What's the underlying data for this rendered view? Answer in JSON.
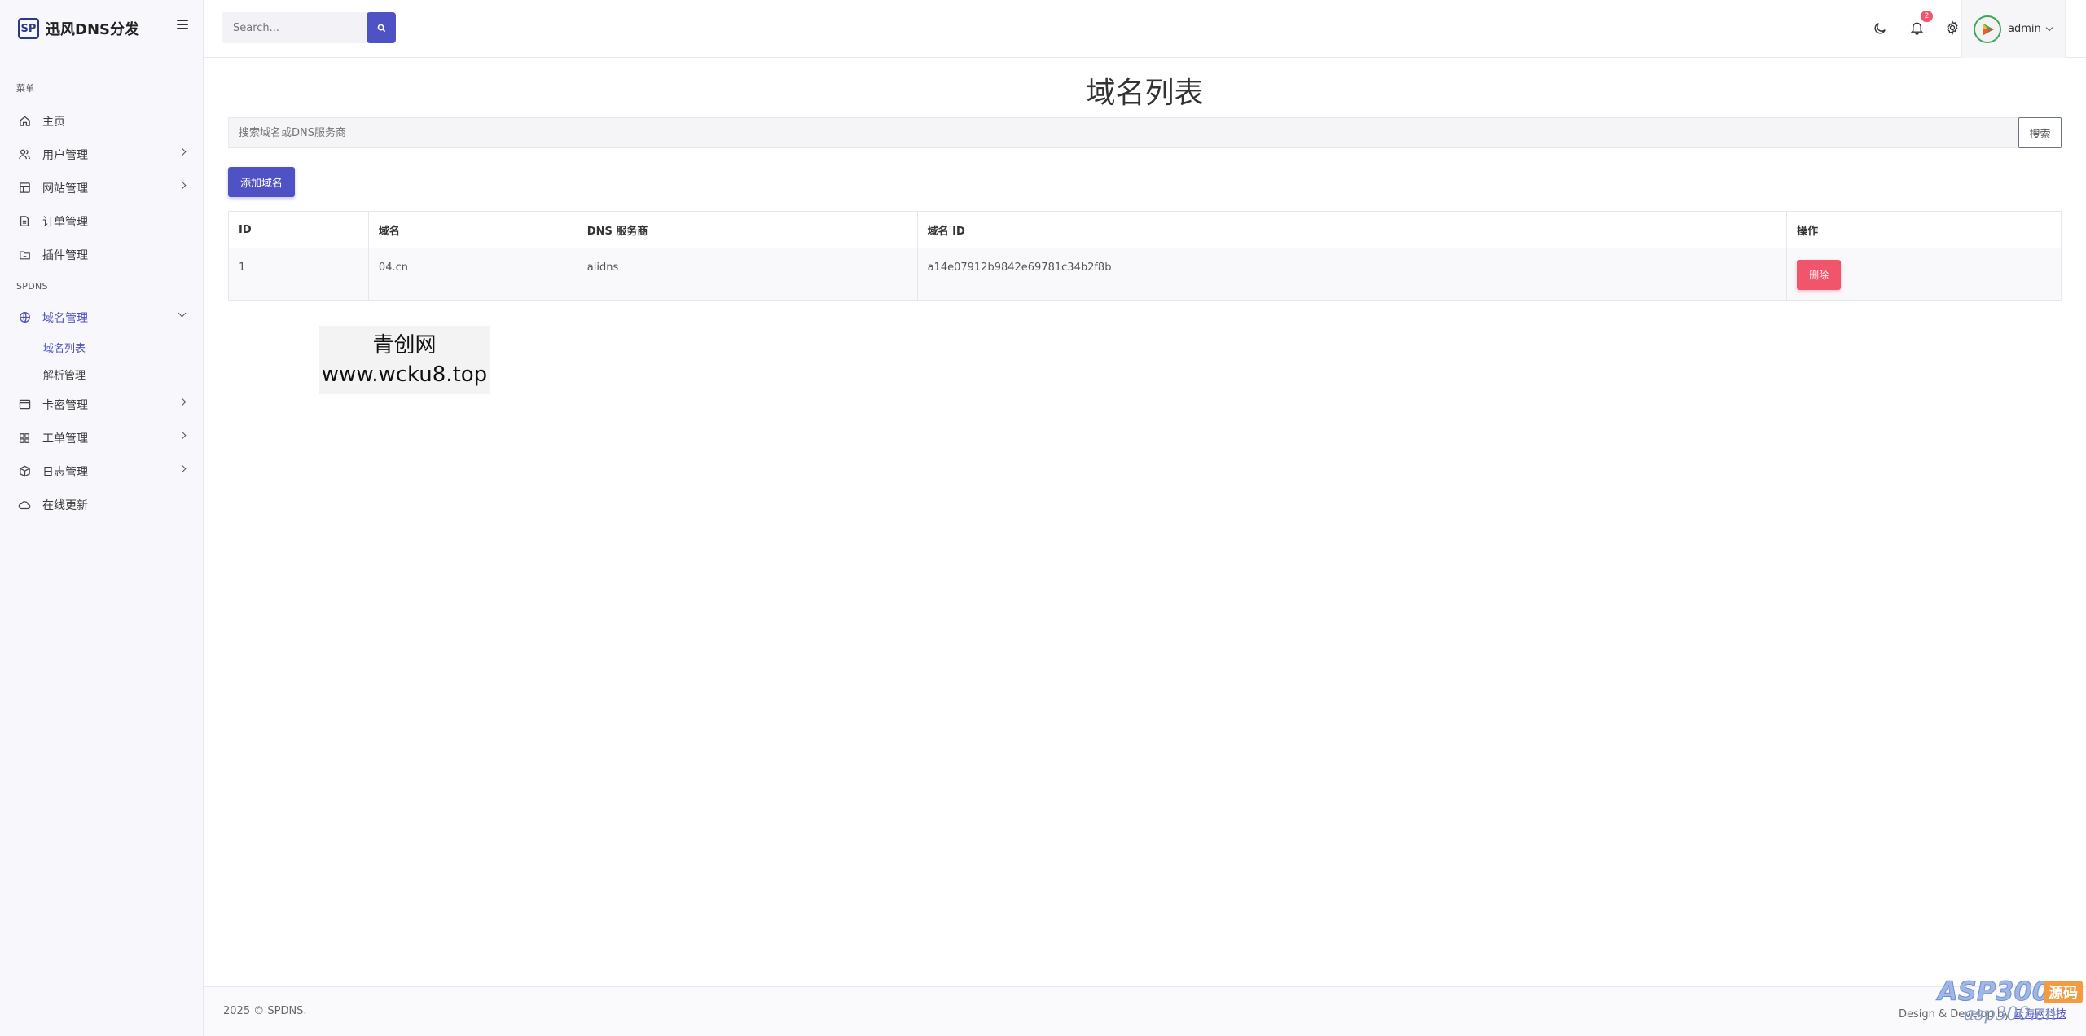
{
  "brand": {
    "logo_text": "SP",
    "name": "迅风DNS分发"
  },
  "sidebar": {
    "section_menu": "菜单",
    "section_spdns": "SPDNS",
    "items": [
      {
        "label": "主页",
        "icon": "home-icon"
      },
      {
        "label": "用户管理",
        "icon": "users-icon"
      },
      {
        "label": "网站管理",
        "icon": "table-icon"
      },
      {
        "label": "订单管理",
        "icon": "document-icon"
      },
      {
        "label": "插件管理",
        "icon": "folder-icon"
      }
    ],
    "spdns_items": [
      {
        "label": "域名管理",
        "icon": "globe-icon",
        "expanded": true,
        "children": [
          {
            "label": "域名列表",
            "active": true
          },
          {
            "label": "解析管理"
          }
        ]
      },
      {
        "label": "卡密管理",
        "icon": "card-icon"
      },
      {
        "label": "工单管理",
        "icon": "grid-icon"
      },
      {
        "label": "日志管理",
        "icon": "box-icon"
      },
      {
        "label": "在线更新",
        "icon": "cloud-icon"
      }
    ]
  },
  "header": {
    "search_placeholder": "Search...",
    "notification_count": "2",
    "user_name": "admin"
  },
  "main": {
    "title": "域名列表",
    "filter_placeholder": "搜索域名或DNS服务商",
    "filter_button": "搜索",
    "add_button": "添加域名",
    "table": {
      "headers": [
        "ID",
        "域名",
        "DNS 服务商",
        "域名 ID",
        "操作"
      ],
      "rows": [
        {
          "id": "1",
          "domain": "04.cn",
          "provider": "alidns",
          "domain_id": "a14e07912b9842e69781c34b2f8b",
          "action": "删除"
        }
      ]
    }
  },
  "watermark": {
    "line1": "青创网",
    "line2": "www.wcku8.top"
  },
  "footer": {
    "copyright": "2025 © SPDNS.",
    "credit_prefix": "Design & Develop by",
    "credit_link": "云海网科技"
  },
  "colors": {
    "primary": "#4f52c4",
    "danger": "#f1556c"
  }
}
